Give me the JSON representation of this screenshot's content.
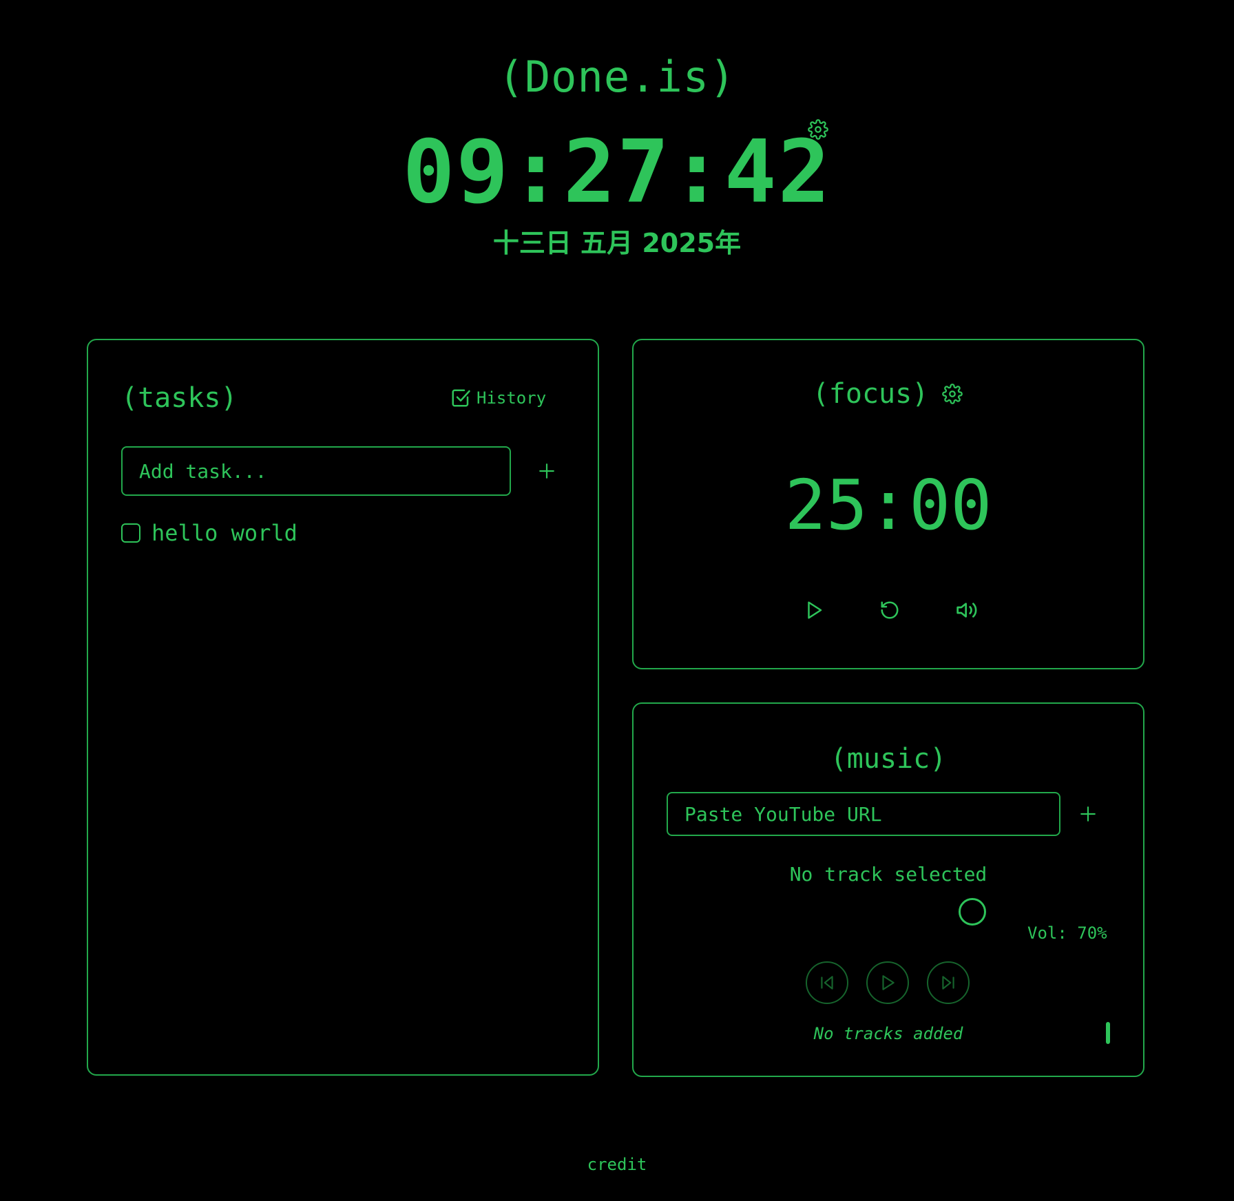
{
  "header": {
    "brand": "(Done.is)",
    "clock": "09:27:42",
    "date": "十三日 五月 2025年",
    "settings_icon": "gear-icon"
  },
  "tasks": {
    "title": "(tasks)",
    "history_label": "History",
    "history_icon": "checkbox-check-icon",
    "input_placeholder": "Add task...",
    "add_icon": "plus-icon",
    "items": [
      {
        "label": "hello world",
        "done": false
      }
    ]
  },
  "focus": {
    "title": "(focus)",
    "settings_icon": "gear-icon",
    "time": "25:00",
    "controls": [
      "play-icon",
      "reset-icon",
      "volume-icon"
    ]
  },
  "music": {
    "title": "(music)",
    "input_placeholder": "Paste YouTube URL",
    "add_icon": "plus-icon",
    "status": "No track selected",
    "volume_label": "Vol: 70%",
    "volume": 0.7,
    "empty_text": "No tracks added",
    "controls": [
      "skip-back-icon",
      "play-icon",
      "skip-forward-icon"
    ]
  },
  "footer": {
    "credit": "credit"
  },
  "colors": {
    "accent": "#2ec45a",
    "border": "#22a84b",
    "muted_border": "#16632c",
    "background": "#000000"
  }
}
